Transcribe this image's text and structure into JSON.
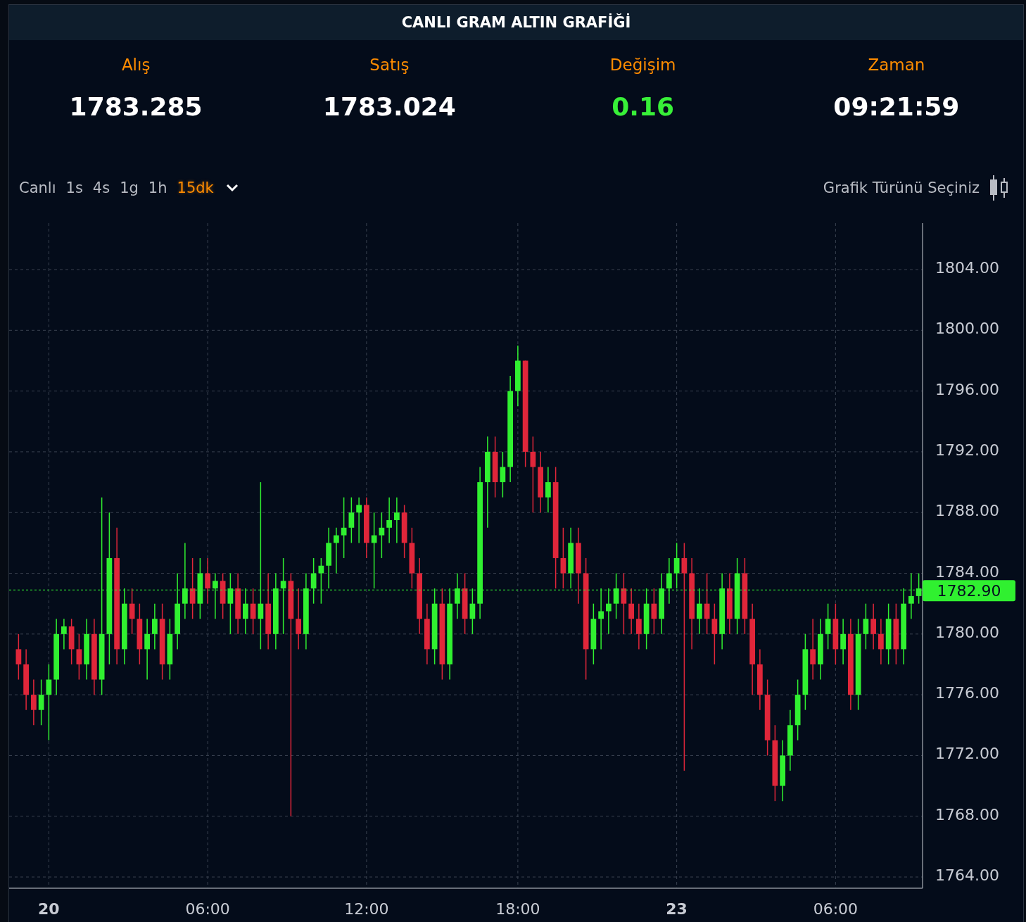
{
  "title": "CANLI GRAM ALTIN GRAFİĞİ",
  "stats": [
    {
      "label": "Alış",
      "value": "1783.285",
      "kind": "price"
    },
    {
      "label": "Satış",
      "value": "1783.024",
      "kind": "price"
    },
    {
      "label": "Değişim",
      "value": "0.16",
      "kind": "change"
    },
    {
      "label": "Zaman",
      "value": "09:21:59",
      "kind": "time"
    }
  ],
  "intervals": [
    {
      "label": "Canlı",
      "selected": false
    },
    {
      "label": "1s",
      "selected": false
    },
    {
      "label": "4s",
      "selected": false
    },
    {
      "label": "1g",
      "selected": false
    },
    {
      "label": "1h",
      "selected": false
    },
    {
      "label": "15dk",
      "selected": true
    }
  ],
  "chart_type_button": "Grafik Türünü Seçiniz",
  "chart": {
    "chart_data": {
      "type": "candlestick",
      "categories": [
        null,
        null,
        null,
        null,
        "20",
        null,
        null,
        null,
        null,
        null,
        null,
        null,
        null,
        null,
        null,
        null,
        null,
        null,
        null,
        null,
        null,
        null,
        null,
        null,
        null,
        "06:00",
        null,
        null,
        null,
        null,
        null,
        null,
        null,
        null,
        null,
        null,
        null,
        null,
        null,
        null,
        null,
        null,
        null,
        null,
        null,
        null,
        "12:00",
        null,
        null,
        null,
        null,
        null,
        null,
        null,
        null,
        null,
        null,
        null,
        null,
        null,
        null,
        null,
        null,
        null,
        null,
        null,
        "18:00",
        null,
        null,
        null,
        null,
        null,
        null,
        null,
        null,
        null,
        null,
        null,
        null,
        null,
        null,
        null,
        null,
        null,
        null,
        null,
        null,
        "23",
        null,
        null,
        null,
        null,
        null,
        null,
        null,
        null,
        null,
        null,
        null,
        null,
        null,
        null,
        null,
        null,
        null,
        null,
        null,
        null,
        "06:00",
        null,
        null,
        null,
        null,
        null,
        null,
        null,
        null,
        null,
        null,
        null
      ],
      "grid": true,
      "ref_lines": [
        {
          "axis": "y",
          "value": 1782.9,
          "label": "1782.90",
          "color": "#30f030"
        }
      ],
      "ylim": [
        1763.26,
        1807.06
      ],
      "ohlc": [
        [
          1779,
          1780,
          1777,
          1778
        ],
        [
          1778,
          1779,
          1775,
          1776
        ],
        [
          1776,
          1777,
          1774,
          1775
        ],
        [
          1775,
          1777,
          1774,
          1776
        ],
        [
          1776,
          1778,
          1773,
          1777
        ],
        [
          1777,
          1781,
          1776,
          1780
        ],
        [
          1780,
          1781,
          1779,
          1780.5
        ],
        [
          1780.5,
          1781,
          1778,
          1779
        ],
        [
          1779,
          1780,
          1777,
          1778
        ],
        [
          1778,
          1781,
          1777,
          1780
        ],
        [
          1780,
          1781,
          1776,
          1777
        ],
        [
          1777,
          1789,
          1776,
          1780
        ],
        [
          1780,
          1788,
          1778,
          1785
        ],
        [
          1785,
          1787,
          1778,
          1779
        ],
        [
          1779,
          1783,
          1778,
          1782
        ],
        [
          1782,
          1783,
          1780,
          1781
        ],
        [
          1781,
          1782,
          1778,
          1779
        ],
        [
          1779,
          1781,
          1777,
          1780
        ],
        [
          1780,
          1782,
          1779,
          1781
        ],
        [
          1781,
          1782,
          1777,
          1778
        ],
        [
          1778,
          1781,
          1777,
          1780
        ],
        [
          1780,
          1784,
          1779,
          1782
        ],
        [
          1782,
          1786,
          1781,
          1783
        ],
        [
          1783,
          1785,
          1781,
          1782
        ],
        [
          1782,
          1785,
          1781,
          1784
        ],
        [
          1784,
          1785,
          1782,
          1783
        ],
        [
          1783,
          1784,
          1781,
          1783.5
        ],
        [
          1783.5,
          1784,
          1781,
          1782
        ],
        [
          1782,
          1784,
          1780,
          1783
        ],
        [
          1783,
          1784,
          1780,
          1781
        ],
        [
          1781,
          1783,
          1780,
          1782
        ],
        [
          1782,
          1783,
          1780,
          1781
        ],
        [
          1781,
          1790,
          1779,
          1782
        ],
        [
          1782,
          1784,
          1779,
          1780
        ],
        [
          1780,
          1784,
          1779,
          1783
        ],
        [
          1783,
          1785,
          1780,
          1783.5
        ],
        [
          1783.5,
          1784,
          1768,
          1781
        ],
        [
          1781,
          1783,
          1779,
          1780
        ],
        [
          1780,
          1784,
          1779,
          1783
        ],
        [
          1783,
          1785,
          1782,
          1784
        ],
        [
          1784,
          1785,
          1782,
          1784.5
        ],
        [
          1784.5,
          1787,
          1783,
          1786
        ],
        [
          1786,
          1787,
          1784,
          1786.5
        ],
        [
          1786.5,
          1789,
          1785,
          1787
        ],
        [
          1787,
          1789,
          1786,
          1788
        ],
        [
          1788,
          1789,
          1786,
          1788.5
        ],
        [
          1788.5,
          1789,
          1785,
          1786
        ],
        [
          1786,
          1788,
          1783,
          1786.5
        ],
        [
          1786.5,
          1788,
          1785,
          1787
        ],
        [
          1787,
          1789,
          1786,
          1787.5
        ],
        [
          1787.5,
          1789,
          1786,
          1788
        ],
        [
          1788,
          1788.5,
          1785,
          1786
        ],
        [
          1786,
          1787,
          1783,
          1784
        ],
        [
          1784,
          1785,
          1780,
          1781
        ],
        [
          1781,
          1782,
          1778,
          1779
        ],
        [
          1779,
          1783,
          1778,
          1782
        ],
        [
          1782,
          1783,
          1777,
          1778
        ],
        [
          1778,
          1783,
          1777,
          1782
        ],
        [
          1782,
          1784,
          1781,
          1783
        ],
        [
          1783,
          1784,
          1780,
          1781
        ],
        [
          1781,
          1783,
          1780,
          1782
        ],
        [
          1782,
          1791,
          1781,
          1790
        ],
        [
          1790,
          1793,
          1787,
          1792
        ],
        [
          1792,
          1793,
          1789,
          1790
        ],
        [
          1790,
          1792,
          1789,
          1791
        ],
        [
          1791,
          1797,
          1790,
          1796
        ],
        [
          1796,
          1799,
          1795,
          1798
        ],
        [
          1798,
          1798,
          1791,
          1792
        ],
        [
          1792,
          1793,
          1788,
          1791
        ],
        [
          1791,
          1792,
          1788,
          1789
        ],
        [
          1789,
          1791,
          1788,
          1790
        ],
        [
          1790,
          1791,
          1783,
          1785
        ],
        [
          1785,
          1787,
          1783,
          1784
        ],
        [
          1784,
          1787,
          1783,
          1786
        ],
        [
          1786,
          1787,
          1782,
          1784
        ],
        [
          1784,
          1785,
          1777,
          1779
        ],
        [
          1779,
          1782,
          1778,
          1781
        ],
        [
          1781,
          1783,
          1779,
          1781.5
        ],
        [
          1781.5,
          1783,
          1780,
          1782
        ],
        [
          1782,
          1784,
          1781,
          1783
        ],
        [
          1783,
          1784,
          1780,
          1782
        ],
        [
          1782,
          1783,
          1780,
          1781
        ],
        [
          1781,
          1782,
          1779,
          1780
        ],
        [
          1780,
          1783,
          1779,
          1782
        ],
        [
          1782,
          1783,
          1780,
          1781
        ],
        [
          1781,
          1784,
          1780,
          1783
        ],
        [
          1783,
          1785,
          1782,
          1784
        ],
        [
          1784,
          1786,
          1783,
          1785
        ],
        [
          1785,
          1786,
          1771,
          1784
        ],
        [
          1784,
          1785,
          1779,
          1781
        ],
        [
          1781,
          1783,
          1780,
          1782
        ],
        [
          1782,
          1784,
          1780,
          1781
        ],
        [
          1781,
          1782,
          1778,
          1780
        ],
        [
          1780,
          1784,
          1779,
          1783
        ],
        [
          1783,
          1784,
          1780,
          1781
        ],
        [
          1781,
          1785,
          1780,
          1784
        ],
        [
          1784,
          1785,
          1780,
          1781
        ],
        [
          1781,
          1782,
          1776,
          1778
        ],
        [
          1778,
          1779,
          1775,
          1776
        ],
        [
          1776,
          1777,
          1772,
          1773
        ],
        [
          1773,
          1774,
          1769,
          1770
        ],
        [
          1770,
          1773,
          1769,
          1772
        ],
        [
          1772,
          1775,
          1771,
          1774
        ],
        [
          1774,
          1777,
          1773,
          1776
        ],
        [
          1776,
          1780,
          1775,
          1779
        ],
        [
          1779,
          1781,
          1777,
          1778
        ],
        [
          1778,
          1781,
          1777,
          1780
        ],
        [
          1780,
          1782,
          1779,
          1781
        ],
        [
          1781,
          1782,
          1778,
          1779
        ],
        [
          1779,
          1781,
          1778,
          1780
        ],
        [
          1780,
          1781,
          1775,
          1776
        ],
        [
          1776,
          1781,
          1775,
          1780
        ],
        [
          1780,
          1782,
          1779,
          1781
        ],
        [
          1781,
          1782,
          1779,
          1780
        ],
        [
          1780,
          1781,
          1778,
          1779
        ],
        [
          1779,
          1782,
          1778,
          1781
        ],
        [
          1781,
          1782,
          1778,
          1779
        ],
        [
          1779,
          1783,
          1778,
          1782
        ],
        [
          1782,
          1784,
          1781,
          1782.5
        ],
        [
          1782.5,
          1784,
          1782,
          1783
        ]
      ],
      "yticks": [
        {
          "value": 1804,
          "label": "1804.00"
        },
        {
          "value": 1800,
          "label": "1800.00"
        },
        {
          "value": 1796,
          "label": "1796.00"
        },
        {
          "value": 1792,
          "label": "1792.00"
        },
        {
          "value": 1788,
          "label": "1788.00"
        },
        {
          "value": 1784,
          "label": "1784.00"
        },
        {
          "value": 1780,
          "label": "1780.00"
        },
        {
          "value": 1776,
          "label": "1776.00"
        },
        {
          "value": 1772,
          "label": "1772.00"
        },
        {
          "value": 1768,
          "label": "1768.00"
        },
        {
          "value": 1764,
          "label": "1764.00"
        }
      ]
    },
    "x_axis_label_bold": [
      true,
      false,
      false,
      false,
      true,
      false
    ]
  }
}
